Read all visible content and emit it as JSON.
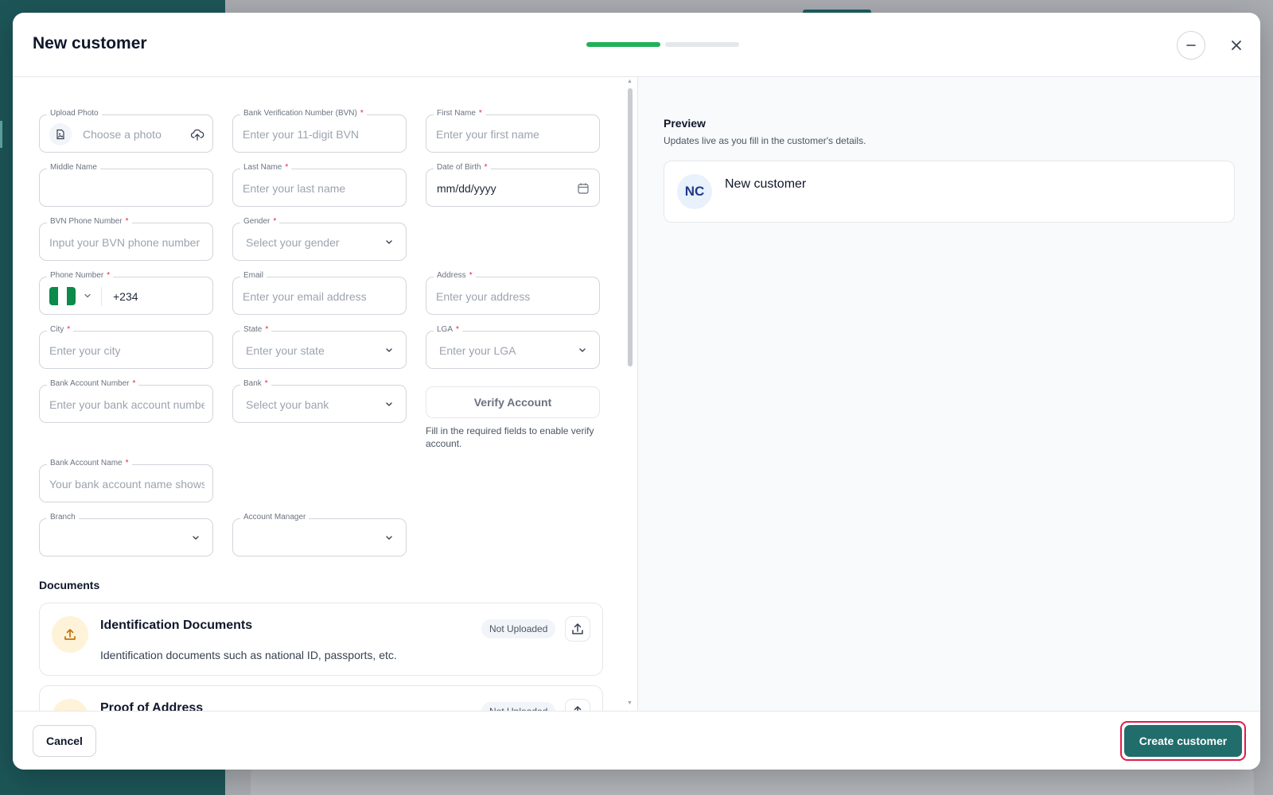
{
  "modal": {
    "title": "New customer",
    "progress_steps": [
      true,
      false
    ]
  },
  "form": {
    "upload_photo": {
      "label": "Upload Photo",
      "placeholder": "Choose a photo"
    },
    "bvn": {
      "label": "Bank Verification Number (BVN)",
      "placeholder": "Enter your 11-digit BVN"
    },
    "first_name": {
      "label": "First Name",
      "placeholder": "Enter your first name"
    },
    "middle_name": {
      "label": "Middle Name",
      "placeholder": ""
    },
    "last_name": {
      "label": "Last Name",
      "placeholder": "Enter your last name"
    },
    "dob": {
      "label": "Date of Birth",
      "placeholder": "mm/dd/yyyy"
    },
    "bvn_phone": {
      "label": "BVN Phone Number",
      "placeholder": "Input your BVN phone number"
    },
    "gender": {
      "label": "Gender",
      "placeholder": "Select your gender"
    },
    "phone": {
      "label": "Phone Number",
      "value": "+234"
    },
    "email": {
      "label": "Email",
      "placeholder": "Enter your email address"
    },
    "address": {
      "label": "Address",
      "placeholder": "Enter your address"
    },
    "city": {
      "label": "City",
      "placeholder": "Enter your city"
    },
    "state": {
      "label": "State",
      "placeholder": "Enter your state"
    },
    "lga": {
      "label": "LGA",
      "placeholder": "Enter your LGA"
    },
    "bank_account_number": {
      "label": "Bank Account Number",
      "placeholder": "Enter your bank account number"
    },
    "bank": {
      "label": "Bank",
      "placeholder": "Select your bank"
    },
    "verify_button": "Verify Account",
    "verify_hint": "Fill in the required fields to enable verify account.",
    "bank_account_name": {
      "label": "Bank Account Name",
      "placeholder": "Your bank account name shows here"
    },
    "branch": {
      "label": "Branch"
    },
    "account_manager": {
      "label": "Account Manager"
    }
  },
  "documents": {
    "title": "Documents",
    "items": [
      {
        "name": "Identification Documents",
        "description": "Identification documents such as national ID, passports, etc.",
        "status": "Not Uploaded"
      },
      {
        "name": "Proof of Address",
        "description": "",
        "status": "Not Uploaded"
      }
    ]
  },
  "preview": {
    "title": "Preview",
    "subtitle": "Updates live as you fill in the customer's details.",
    "avatar_initials": "NC",
    "name": "New customer"
  },
  "footer": {
    "cancel_label": "Cancel",
    "create_label": "Create customer"
  },
  "colors": {
    "primary": "#216d6b",
    "progress": "#22b05a",
    "required": "#e11d48",
    "highlight": "#e11d48"
  },
  "icons": {
    "minimize": "minus-icon",
    "close": "close-icon",
    "photo": "image-file-icon",
    "upload": "cloud-upload-icon",
    "calendar": "calendar-icon",
    "chevron": "chevron-down-icon",
    "flag": "nigeria-flag-icon",
    "doc_upload": "upload-icon"
  }
}
